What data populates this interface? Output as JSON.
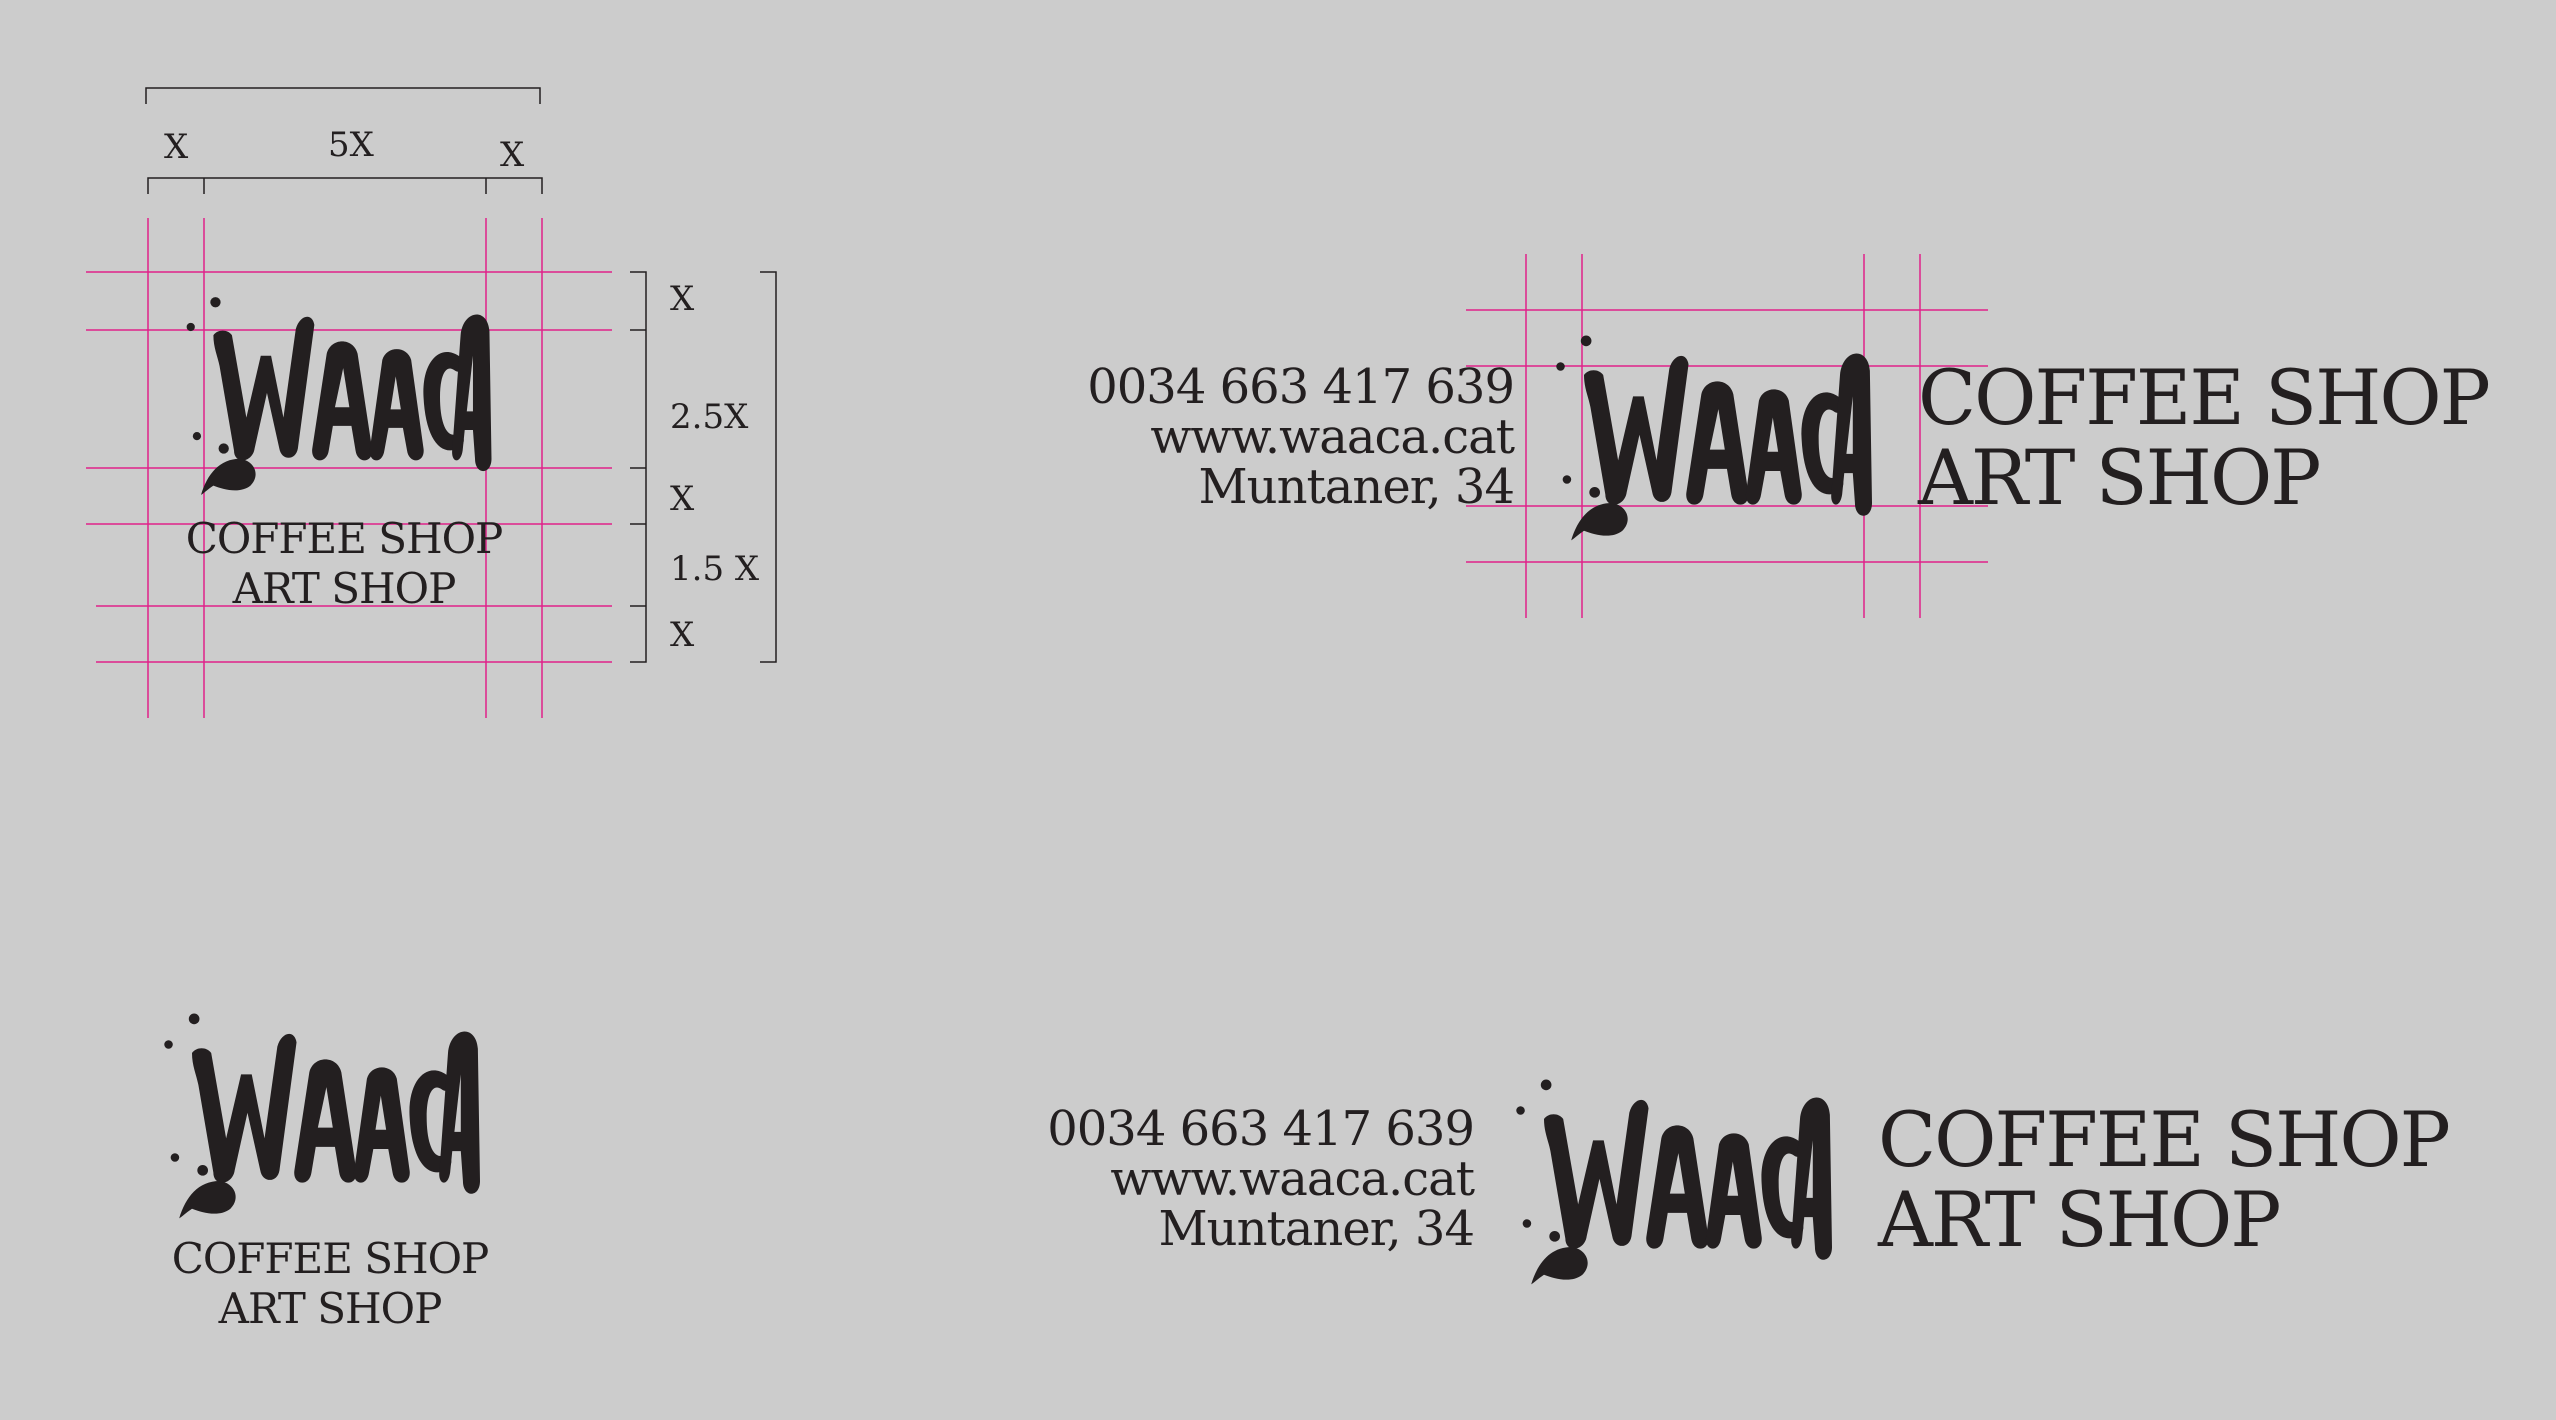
{
  "logo": {
    "wordmark": "WAACA",
    "icon": "waaca-splash-wordmark"
  },
  "tagline": {
    "line1": "COFFEE SHOP",
    "line2": "ART SHOP"
  },
  "contact": {
    "phone": "0034 663 417 639",
    "web": "www.waaca.cat",
    "address": "Muntaner, 34"
  },
  "construction": {
    "width_labels": {
      "left": "X",
      "center": "5X",
      "right": "X"
    },
    "height_labels": [
      "X",
      "2.5X",
      "X",
      "1.5 X",
      "X"
    ]
  },
  "colors": {
    "background": "#cccccc",
    "ink": "#231f20",
    "guides": "#e0218a"
  }
}
